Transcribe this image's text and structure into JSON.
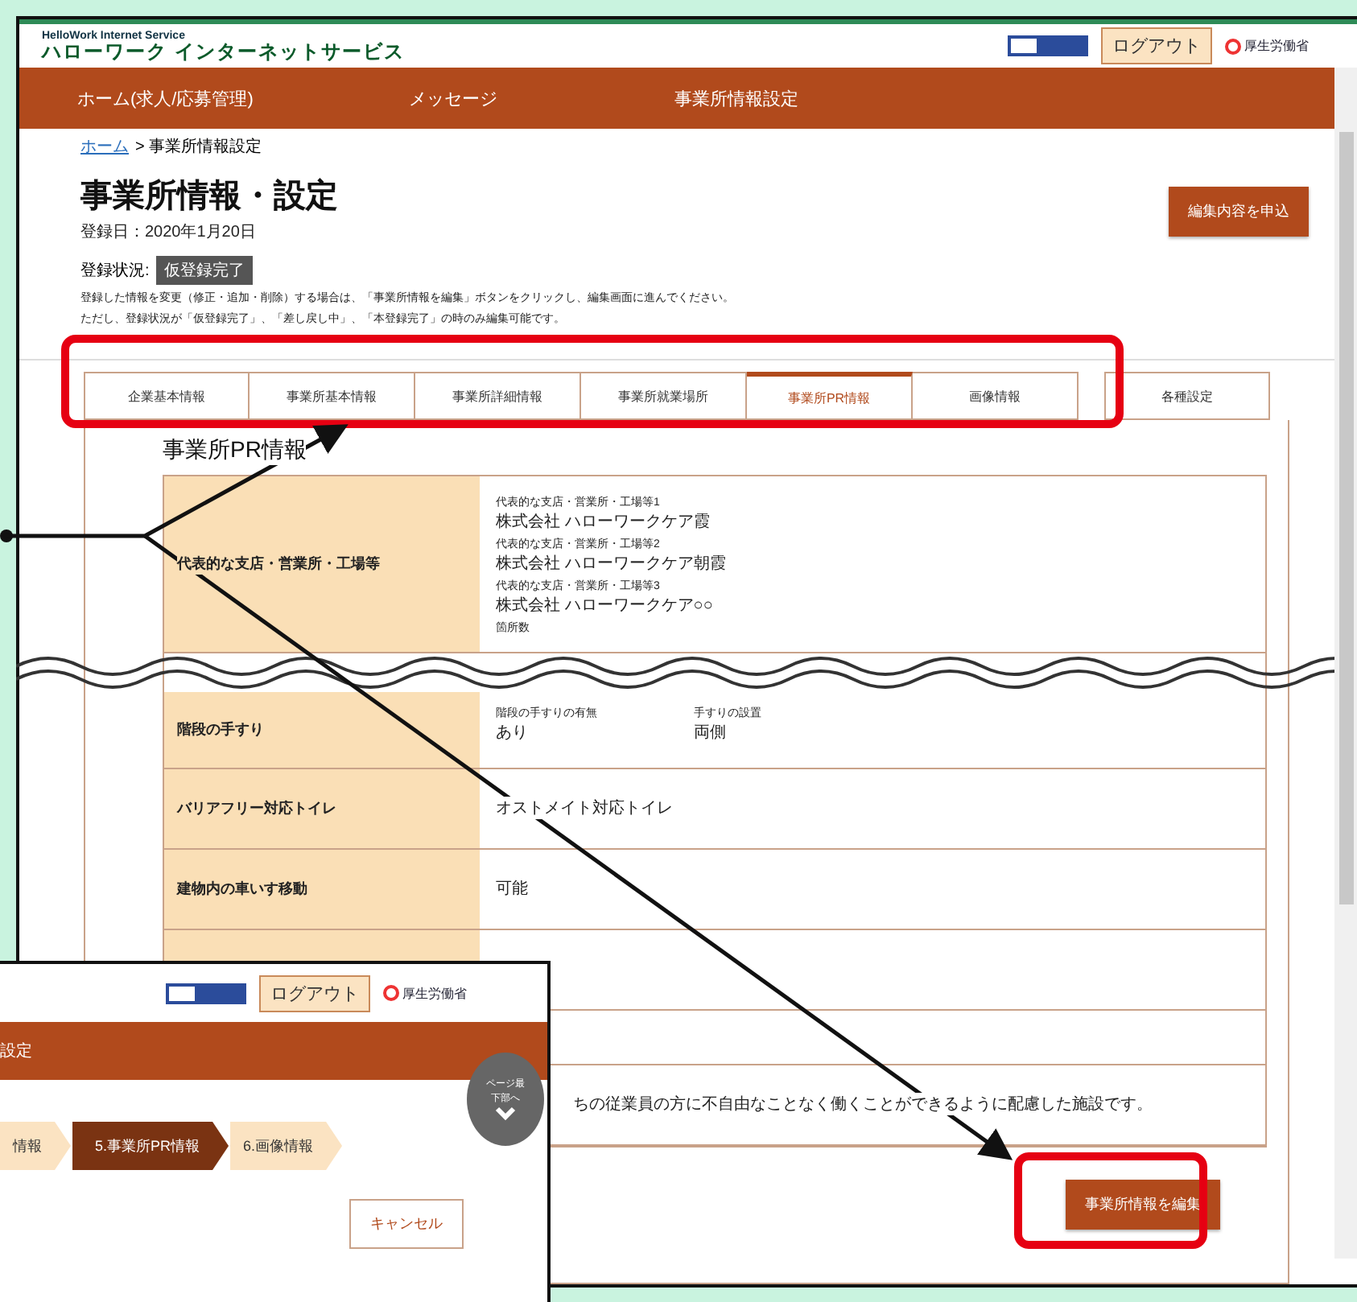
{
  "main_window": {
    "service_name_en": "HelloWork Internet Service",
    "service_name": "ハローワーク インターネットサービス",
    "logout": "ログアウト",
    "ministry": "厚生労働省",
    "nav": [
      "ホーム(求人/応募管理)",
      "メッセージ",
      "事業所情報設定"
    ],
    "breadcrumb": {
      "home": "ホーム",
      "current": "> 事業所情報設定"
    },
    "title": "事業所情報・設定",
    "registered_date": "登録日：2020年1月20日",
    "status_label": "登録状況:",
    "status": "仮登録完了",
    "notes": [
      "登録した情報を変更（修正・追加・削除）する場合は、「事業所情報を編集」ボタンをクリックし、編集画面に進んでください。",
      "ただし、登録状況が「仮登録完了」、「差し戻し中」、「本登録完了」の時のみ編集可能です。"
    ],
    "apply_button": "編集内容を申込",
    "tabs": [
      {
        "label": "企業基本情報",
        "selected": false
      },
      {
        "label": "事業所基本情報",
        "selected": false
      },
      {
        "label": "事業所詳細情報",
        "selected": false
      },
      {
        "label": "事業所就業場所",
        "selected": false
      },
      {
        "label": "事業所PR情報",
        "selected": true
      },
      {
        "label": "画像情報",
        "selected": false
      },
      {
        "label": "各種設定",
        "selected": false
      }
    ],
    "section_title": "事業所PR情報",
    "rows": [
      {
        "kind": "stacked",
        "label": "代表的な支店・営業所・工場等",
        "items": [
          {
            "caption": "代表的な支店・営業所・工場等1",
            "value": "株式会社 ハローワークケア霞"
          },
          {
            "caption": "代表的な支店・営業所・工場等2",
            "value": "株式会社 ハローワークケア朝霞"
          },
          {
            "caption": "代表的な支店・営業所・工場等3",
            "value": "株式会社 ハローワークケア○○"
          },
          {
            "caption": "箇所数"
          }
        ]
      },
      {
        "kind": "break"
      },
      {
        "kind": "pairs",
        "label": "階段の手すり",
        "items": [
          {
            "caption": "階段の手すりの有無",
            "value": "あり"
          },
          {
            "caption": "手すりの設置",
            "value": "両側"
          }
        ]
      },
      {
        "kind": "text",
        "label": "バリアフリー対応トイレ",
        "value": "オストメイト対応トイレ"
      },
      {
        "kind": "text",
        "label": "建物内の車いす移動",
        "value": "可能"
      },
      {
        "kind": "text"
      },
      {
        "kind": "blank"
      },
      {
        "kind": "text",
        "value": "ちの従業員の方に不自由なことなく働くことができるように配慮した施設です。"
      }
    ],
    "edit_button": "事業所情報を編集"
  },
  "inset_window": {
    "logout": "ログアウト",
    "ministry": "厚生労働省",
    "nav": "設定",
    "steps": [
      {
        "label": "情報",
        "selected": false
      },
      {
        "label": "5.事業所PR情報",
        "selected": true
      },
      {
        "label": "6.画像情報",
        "selected": false
      }
    ],
    "cancel_button": "キャンセル"
  },
  "page_bottom_button": "ページ最下部へ"
}
